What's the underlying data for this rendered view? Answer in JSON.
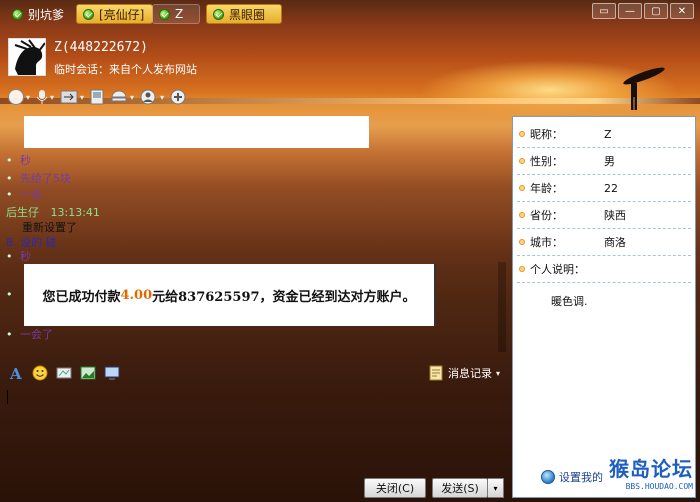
{
  "tabs": [
    {
      "label": "别坑爹",
      "state": "normal"
    },
    {
      "label": "[亮仙仔]",
      "state": "active"
    },
    {
      "label": "Z",
      "state": "dim"
    },
    {
      "label": "黑眼圈",
      "state": "active"
    }
  ],
  "window_controls": [
    "▭",
    "—",
    "▢",
    "✕"
  ],
  "contact": {
    "name": "Z(448222672)",
    "subtitle": "临时会话：来自个人发布网站"
  },
  "toolbar_icons": [
    "video-icon",
    "microphone-icon",
    "transfer-icon",
    "screen-icon",
    "remote-icon",
    "add-contact-icon",
    "more-icon"
  ],
  "chat": {
    "messages": [
      {
        "text": "秒",
        "color": "#6a2a8a",
        "style": "bullet"
      },
      {
        "text": "先给了5块",
        "color": "#6a2a8a",
        "style": "bullet"
      },
      {
        "text": "一会",
        "color": "#6a2a8a",
        "style": "bullet"
      }
    ],
    "sender": "后生仔",
    "time": "13:13:41",
    "sender_msg": "重新设置了",
    "tail_messages": [
      {
        "text": "8. 设的 碰",
        "color": "#2a2ab0"
      },
      {
        "text": "秒",
        "color": "#6a2a8a"
      }
    ],
    "payment": {
      "prefix": "您已成功付款",
      "amount": "4.00",
      "suffix": "元给837625597，资金已经到达对方账户。"
    },
    "last": "一会了"
  },
  "input_toolbar": {
    "history_label": "消息记录"
  },
  "buttons": {
    "close": "关闭(C)",
    "send": "发送(S)",
    "send_arrow": "▾"
  },
  "profile": {
    "rows": [
      {
        "label": "昵称：",
        "value": "Z"
      },
      {
        "label": "性别：",
        "value": "男"
      },
      {
        "label": "年龄：",
        "value": "22"
      },
      {
        "label": "省份：",
        "value": "陕西"
      },
      {
        "label": "城市：",
        "value": "商洛"
      },
      {
        "label": "个人说明：",
        "value": ""
      }
    ],
    "description": "暖色调.",
    "footer_link": "设置我的"
  },
  "watermark": {
    "main": "猴岛论坛",
    "sub": "BBS.HOUDAO.COM"
  },
  "colors": {
    "accent_tab": "#e8ad2c",
    "panel_border": "#7c9bb8",
    "payment_amount": "#e06a00",
    "sender_green": "#6cd36c"
  }
}
